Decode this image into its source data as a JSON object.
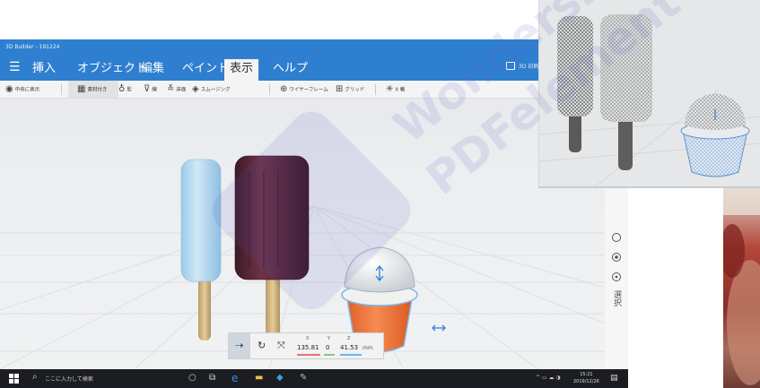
{
  "window": {
    "title": "3D Builder - 191224"
  },
  "ribbon": {
    "menu_icon": "hamburger-menu-icon",
    "tabs": [
      {
        "label": "挿入",
        "active": false
      },
      {
        "label": "オブジェクト",
        "active": false
      },
      {
        "label": "編集",
        "active": false
      },
      {
        "label": "ペイント",
        "active": false
      },
      {
        "label": "表示",
        "active": true
      },
      {
        "label": "ヘルプ",
        "active": false
      }
    ],
    "right_label": "3D 印刷"
  },
  "toolbar": {
    "items": [
      {
        "icon": "eye-icon",
        "label": "中央に表示"
      },
      {
        "icon": "material-icon",
        "label": "素材付き"
      },
      {
        "icon": "bulb-icon",
        "label": "影"
      },
      {
        "icon": "render-icon",
        "label": "線"
      },
      {
        "icon": "floor-icon",
        "label": "床面"
      },
      {
        "icon": "smoothing-icon",
        "label": "スムージング"
      },
      {
        "icon": "wireframe-icon",
        "label": "ワイヤーフレーム"
      },
      {
        "icon": "grid-icon",
        "label": "グリッド"
      },
      {
        "icon": "axis-icon",
        "label": "X 軸"
      }
    ]
  },
  "side_panel": {
    "label": "選択"
  },
  "coordinates": {
    "x_label": "X",
    "y_label": "Y",
    "z_label": "Z",
    "x": "135.81",
    "y": "0",
    "z": "41.53",
    "unit": "mm"
  },
  "taskbar": {
    "search_placeholder": "ここに入力して検索",
    "clock_time": "15:21",
    "clock_date": "2019/12/26"
  },
  "watermark": {
    "line1": "Wondershare",
    "line2": "PDFelement"
  },
  "colors": {
    "ribbon_blue": "#2f7fd0",
    "popsicle_blue": "#b9dcf2",
    "popsicle_chocolate": "#5b2736",
    "cup_orange": "#f0733a",
    "watermark_purple": "#5b5fc7"
  }
}
